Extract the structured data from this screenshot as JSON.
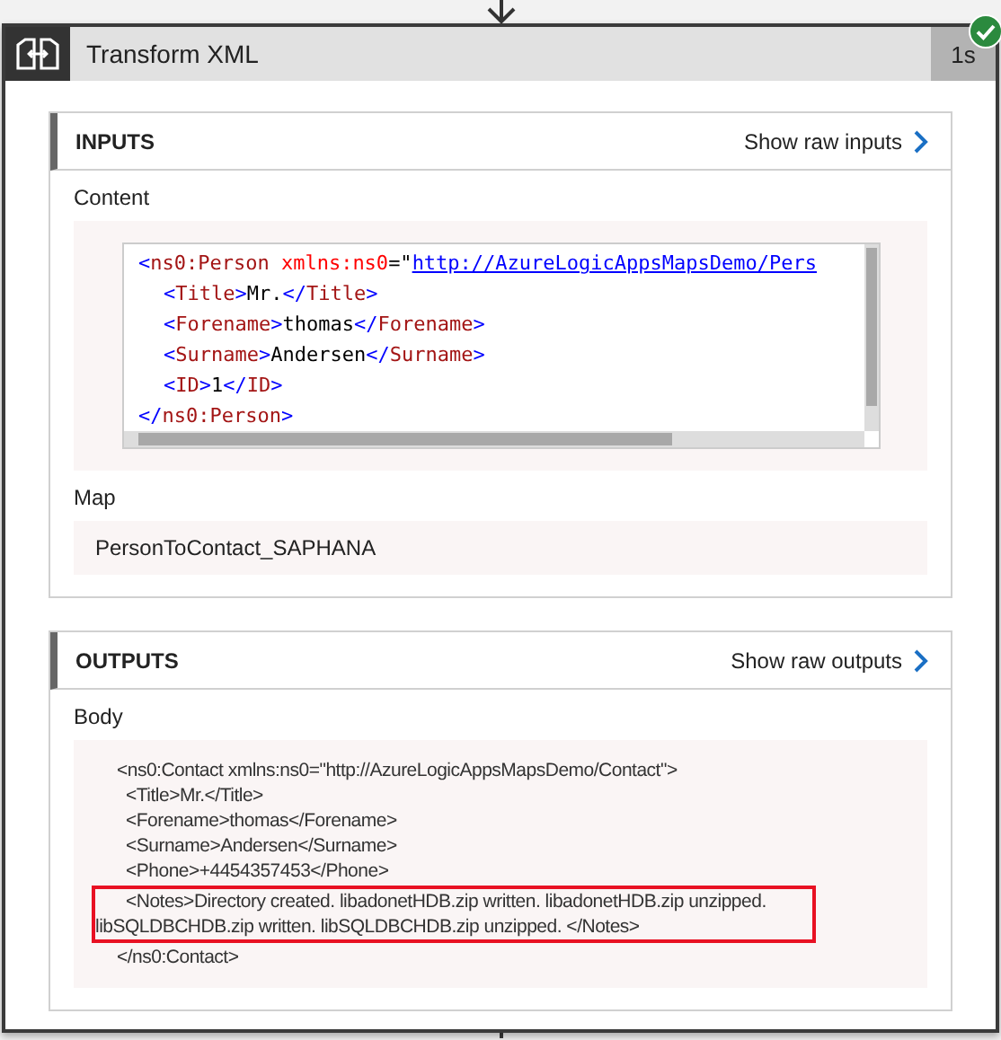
{
  "action": {
    "title": "Transform XML",
    "duration": "1s",
    "succeeded": true
  },
  "inputs": {
    "heading": "INPUTS",
    "raw_link": "Show raw inputs",
    "fields": [
      {
        "kind": "code",
        "label": "Content",
        "lines": [
          {
            "indented": false,
            "tokens": [
              {
                "kind": "bracket",
                "text": "<"
              },
              {
                "kind": "tag",
                "text": "ns0:Person"
              },
              {
                "kind": "attr",
                "text": "xmlns:ns0"
              },
              {
                "kind": "text",
                "text": "=\""
              },
              {
                "kind": "link",
                "text": "http://AzureLogicAppsMapsDemo/Pers"
              }
            ]
          },
          {
            "indented": true,
            "tokens": [
              {
                "kind": "bracket",
                "text": "<"
              },
              {
                "kind": "tag",
                "text": "Title"
              },
              {
                "kind": "bracket",
                "text": ">"
              },
              {
                "kind": "text",
                "text": "Mr."
              },
              {
                "kind": "bracket",
                "text": "</"
              },
              {
                "kind": "tag",
                "text": "Title"
              },
              {
                "kind": "bracket",
                "text": ">"
              }
            ]
          },
          {
            "indented": true,
            "tokens": [
              {
                "kind": "bracket",
                "text": "<"
              },
              {
                "kind": "tag",
                "text": "Forename"
              },
              {
                "kind": "bracket",
                "text": ">"
              },
              {
                "kind": "text",
                "text": "thomas"
              },
              {
                "kind": "bracket",
                "text": "</"
              },
              {
                "kind": "tag",
                "text": "Forename"
              },
              {
                "kind": "bracket",
                "text": ">"
              }
            ]
          },
          {
            "indented": true,
            "tokens": [
              {
                "kind": "bracket",
                "text": "<"
              },
              {
                "kind": "tag",
                "text": "Surname"
              },
              {
                "kind": "bracket",
                "text": ">"
              },
              {
                "kind": "text",
                "text": "Andersen"
              },
              {
                "kind": "bracket",
                "text": "</"
              },
              {
                "kind": "tag",
                "text": "Surname"
              },
              {
                "kind": "bracket",
                "text": ">"
              }
            ]
          },
          {
            "indented": true,
            "tokens": [
              {
                "kind": "bracket",
                "text": "<"
              },
              {
                "kind": "tag",
                "text": "ID"
              },
              {
                "kind": "bracket",
                "text": ">"
              },
              {
                "kind": "text",
                "text": "1"
              },
              {
                "kind": "bracket",
                "text": "</"
              },
              {
                "kind": "tag",
                "text": "ID"
              },
              {
                "kind": "bracket",
                "text": ">"
              }
            ]
          },
          {
            "indented": false,
            "tokens": [
              {
                "kind": "bracket",
                "text": "</"
              },
              {
                "kind": "tag",
                "text": "ns0:Person"
              },
              {
                "kind": "bracket",
                "text": ">"
              }
            ]
          }
        ]
      },
      {
        "kind": "text",
        "label": "Map",
        "value": "PersonToContact_SAPHANA"
      }
    ]
  },
  "outputs": {
    "heading": "OUTPUTS",
    "raw_link": "Show raw outputs",
    "fields": [
      {
        "kind": "body",
        "label": "Body",
        "lines": [
          {
            "text": "<ns0:Contact xmlns:ns0=\"http://AzureLogicAppsMapsDemo/Contact\">",
            "indented": false,
            "highlighted": false
          },
          {
            "text": "<Title>Mr.</Title>",
            "indented": true,
            "highlighted": false
          },
          {
            "text": "<Forename>thomas</Forename>",
            "indented": true,
            "highlighted": false
          },
          {
            "text": "<Surname>Andersen</Surname>",
            "indented": true,
            "highlighted": false
          },
          {
            "text": "<Phone>+4454357453</Phone>",
            "indented": true,
            "highlighted": false
          },
          {
            "text": "<Notes>Directory created. libadonetHDB.zip written. libadonetHDB.zip unzipped. libSQLDBCHDB.zip written. libSQLDBCHDB.zip unzipped. </Notes>",
            "indented": true,
            "highlighted": true
          },
          {
            "text": "</ns0:Contact>",
            "indented": false,
            "highlighted": false
          }
        ]
      }
    ]
  }
}
